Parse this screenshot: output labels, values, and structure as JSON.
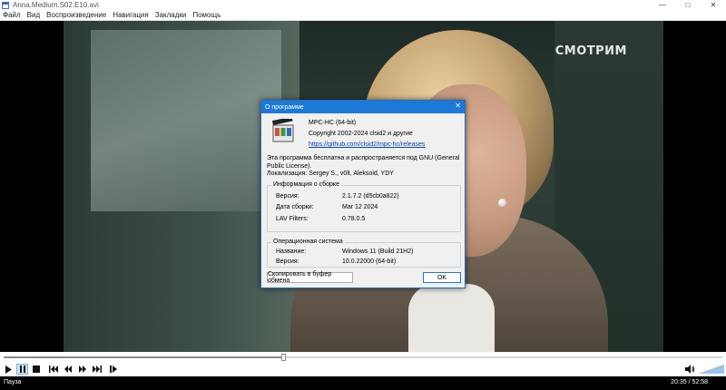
{
  "window": {
    "title": "Anna.Medium.S02.E10.avi",
    "controls": [
      "—",
      "□",
      "✕"
    ]
  },
  "menu": [
    "Файл",
    "Вид",
    "Воспроизведение",
    "Навигация",
    "Закладки",
    "Помощь"
  ],
  "video": {
    "watermark": "СМОТРИМ"
  },
  "dialog": {
    "title": "О программе",
    "product": "MPC-HC (64-bit)",
    "copyright": "Copyright 2002-2024 clsid2 и другие",
    "link": "https://github.com/clsid2/mpc-hc/releases",
    "license": "Эта программа бесплатна и распространяется под GNU (General Public License).",
    "localization": "Локализация: Sergey S., v0lt, Aleksoid, YDY",
    "build_group": {
      "title": "Информация о сборке",
      "rows": [
        {
          "label": "Версия:",
          "value": "2.1.7.2 (d5cb0a822)"
        },
        {
          "label": "Дата сборки:",
          "value": "Mar 12 2024"
        },
        {
          "label": "LAV Filters:",
          "value": "0.78.0.5"
        }
      ]
    },
    "os_group": {
      "title": "Операционная система",
      "rows": [
        {
          "label": "Название:",
          "value": "Windows 11 (Build 21H2)"
        },
        {
          "label": "Версия:",
          "value": "10.0.22000 (64-bit)"
        }
      ]
    },
    "copy_button": "Скопировать в буфер обмена",
    "ok_button": "OK"
  },
  "player": {
    "progress": 0.39,
    "volume": 1.0,
    "status": "Пауза",
    "time": "20:35 / 52:58"
  },
  "colors": {
    "accent": "#1d79d8",
    "link": "#0645ad"
  }
}
